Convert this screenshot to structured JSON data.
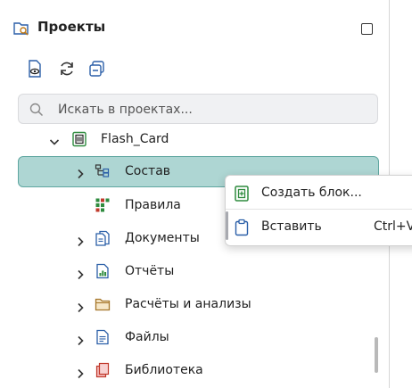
{
  "panel": {
    "title": "Проекты",
    "icons": {
      "header": "project-folder-search-icon",
      "maximize": "maximize-icon"
    }
  },
  "toolbar": {
    "buttons": [
      {
        "name": "show-file-icon"
      },
      {
        "name": "refresh-icon"
      },
      {
        "name": "collapse-all-icon"
      }
    ]
  },
  "search": {
    "placeholder": "Искать в проектах...",
    "value": "",
    "icon": "search-icon"
  },
  "tree": {
    "root": {
      "label": "Flash_Card",
      "icon": "flash-card-icon",
      "expanded": true
    },
    "items": [
      {
        "label": "Состав",
        "icon": "structure-icon",
        "selected": true,
        "expandable": true
      },
      {
        "label": "Правила",
        "icon": "rules-icon",
        "expandable": false
      },
      {
        "label": "Документы",
        "icon": "documents-icon",
        "expandable": true
      },
      {
        "label": "Отчёты",
        "icon": "reports-icon",
        "expandable": true
      },
      {
        "label": "Расчёты и анализы",
        "icon": "calculations-folder-icon",
        "expandable": true
      },
      {
        "label": "Файлы",
        "icon": "files-icon",
        "expandable": true
      },
      {
        "label": "Библиотека",
        "icon": "library-icon",
        "expandable": true
      }
    ]
  },
  "context_menu": {
    "items": [
      {
        "label": "Создать блок...",
        "icon": "create-block-icon",
        "shortcut": ""
      },
      {
        "label": "Вставить",
        "icon": "paste-icon",
        "shortcut": "Ctrl+V"
      }
    ]
  },
  "colors": {
    "selection": "#aed6d3",
    "selection_border": "#5fa6a0",
    "accent_green": "#2e8b3e",
    "icon_blue": "#2b5fa8"
  }
}
